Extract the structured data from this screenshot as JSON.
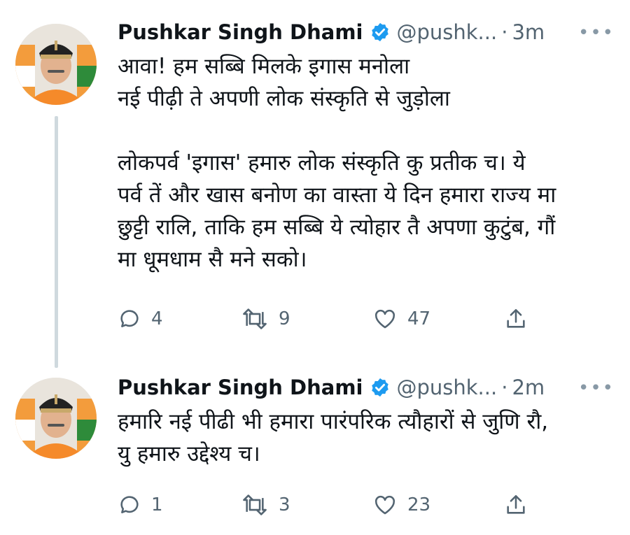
{
  "tweets": [
    {
      "author": "Pushkar Singh Dhami",
      "handle": "@pushk...",
      "separator": "·",
      "time": "3m",
      "more": "•••",
      "lines": [
        "आवा! हम सब्बि मिलके इगास मनोला",
        "नई पीढ़ी ते अपणी लोक संस्कृति से जुड़ोला",
        "लोकपर्व 'इगास' हमारु लोक संस्कृति कु प्रतीक च। ये",
        "पर्व तें और खास बनोण का वास्ता ये दिन हमारा राज्य मा",
        "छुट्टी रालि, ताकि हम सब्बि ये त्योहार तै अपणा कुटुंब, गौं",
        "मा धूमधाम सै मने सको।"
      ],
      "replies": "4",
      "retweets": "9",
      "likes": "47"
    },
    {
      "author": "Pushkar Singh Dhami",
      "handle": "@pushk...",
      "separator": "·",
      "time": "2m",
      "more": "•••",
      "lines": [
        "हमारि नई पीढी भी हमारा पारंपरिक त्यौहारों से जुणि रौ,",
        "यु हमारु उद्देश्य च।"
      ],
      "replies": "1",
      "retweets": "3",
      "likes": "23"
    }
  ],
  "colors": {
    "verified": "#1d9bf0",
    "muted": "#536471",
    "line": "#cfd9de"
  },
  "icons": [
    "verified-badge-icon",
    "more-icon",
    "reply-icon",
    "retweet-icon",
    "like-icon",
    "share-icon"
  ]
}
